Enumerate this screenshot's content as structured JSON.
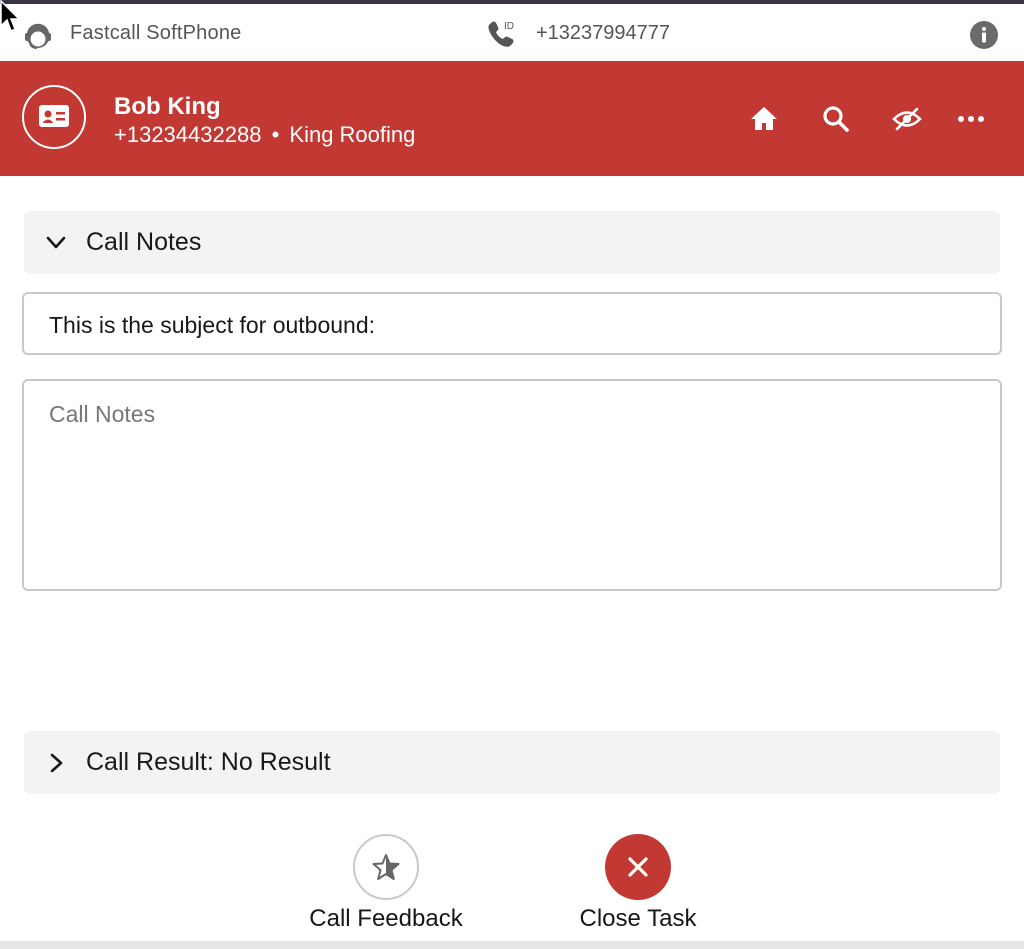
{
  "app": {
    "title": "Fastcall SoftPhone",
    "caller_id_number": "+13237994777",
    "caller_id_badge": "ID"
  },
  "contact": {
    "name": "Bob King",
    "phone": "+13234432288",
    "separator": "•",
    "company": "King Roofing"
  },
  "header_icons": [
    "home-icon",
    "search-icon",
    "hide-icon",
    "more-icon"
  ],
  "call_notes_section": {
    "title": "Call Notes",
    "expanded": true
  },
  "subject_field": {
    "value": "This is the subject for outbound:"
  },
  "notes_field": {
    "value": "",
    "placeholder": "Call Notes"
  },
  "call_result_section": {
    "title": "Call Result: No Result",
    "expanded": false
  },
  "actions": {
    "feedback_label": "Call Feedback",
    "close_label": "Close Task"
  },
  "colors": {
    "brand_red": "#c23934",
    "section_bg": "#f3f3f3",
    "border_gray": "#c9c9c9"
  }
}
